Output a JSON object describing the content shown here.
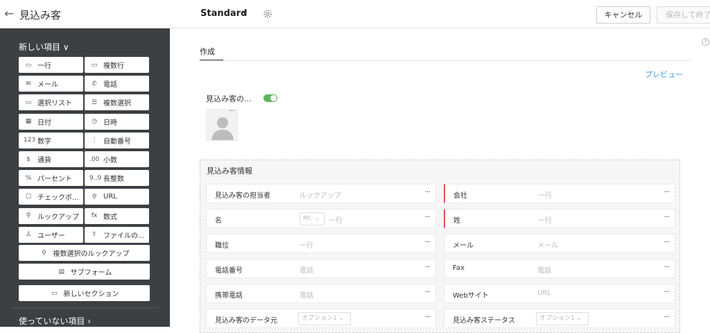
{
  "header": {
    "back_icon": "arrow-left-icon",
    "title": "見込み客",
    "layout_name": "Standard",
    "cancel_label": "キャンセル",
    "save_label": "保存して終了"
  },
  "sidebar": {
    "new_items_label": "新しい項目",
    "fields": [
      {
        "label": "一行",
        "icon": "single-line-icon",
        "glyph": "▭"
      },
      {
        "label": "複数行",
        "icon": "multi-line-icon",
        "glyph": "▭"
      },
      {
        "label": "メール",
        "icon": "mail-icon",
        "glyph": "✉"
      },
      {
        "label": "電話",
        "icon": "phone-icon",
        "glyph": "✆"
      },
      {
        "label": "選択リスト",
        "icon": "picklist-icon",
        "glyph": "▭"
      },
      {
        "label": "複数選択",
        "icon": "multi-select-icon",
        "glyph": "☰"
      },
      {
        "label": "日付",
        "icon": "calendar-icon",
        "glyph": "▦"
      },
      {
        "label": "日時",
        "icon": "datetime-icon",
        "glyph": "◷"
      },
      {
        "label": "数字",
        "icon": "number-icon",
        "glyph": "123"
      },
      {
        "label": "自動番号",
        "icon": "auto-number-icon",
        "glyph": "⋮"
      },
      {
        "label": "通貨",
        "icon": "currency-icon",
        "glyph": "$"
      },
      {
        "label": "小数",
        "icon": "decimal-icon",
        "glyph": ".00"
      },
      {
        "label": "パーセント",
        "icon": "percent-icon",
        "glyph": "%"
      },
      {
        "label": "長整数",
        "icon": "long-integer-icon",
        "glyph": "9..9"
      },
      {
        "label": "チェックボ...",
        "icon": "checkbox-icon",
        "glyph": "☐"
      },
      {
        "label": "URL",
        "icon": "link-icon",
        "glyph": "⚲"
      },
      {
        "label": "ルックアップ",
        "icon": "lookup-icon",
        "glyph": "⚲"
      },
      {
        "label": "数式",
        "icon": "formula-icon",
        "glyph": "fx"
      },
      {
        "label": "ユーザー",
        "icon": "user-icon",
        "glyph": "♙"
      },
      {
        "label": "ファイルの...",
        "icon": "upload-icon",
        "glyph": "⇪"
      }
    ],
    "multi_lookup_label": "複数選択のルックアップ",
    "subform_label": "サブフォーム",
    "new_section_label": "新しいセクション",
    "unused_items_label": "使っていない項目"
  },
  "main": {
    "tab_label": "作成",
    "preview_label": "プレビュー",
    "image_field_label": "見込み客の...",
    "section_title": "見込み客情報",
    "rows": [
      {
        "label": "見込み客の担当者",
        "hint": "ルックアップ",
        "required": false,
        "select": ""
      },
      {
        "label": "会社",
        "hint": "一行",
        "required": true,
        "select": ""
      },
      {
        "label": "名",
        "hint": "一行",
        "required": false,
        "select": "Mr."
      },
      {
        "label": "姓",
        "hint": "一行",
        "required": true,
        "select": ""
      },
      {
        "label": "職位",
        "hint": "一行",
        "required": false,
        "select": ""
      },
      {
        "label": "メール",
        "hint": "メール",
        "required": false,
        "select": ""
      },
      {
        "label": "電話番号",
        "hint": "電話",
        "required": false,
        "select": ""
      },
      {
        "label": "Fax",
        "hint": "電話",
        "required": false,
        "select": ""
      },
      {
        "label": "携帯電話",
        "hint": "電話",
        "required": false,
        "select": ""
      },
      {
        "label": "Webサイト",
        "hint": "URL",
        "required": false,
        "select": ""
      },
      {
        "label": "見込み客のデータ元",
        "hint": "",
        "required": false,
        "select": "オプション1"
      },
      {
        "label": "見込み客ステータス",
        "hint": "",
        "required": false,
        "select": "オプション1"
      }
    ]
  }
}
